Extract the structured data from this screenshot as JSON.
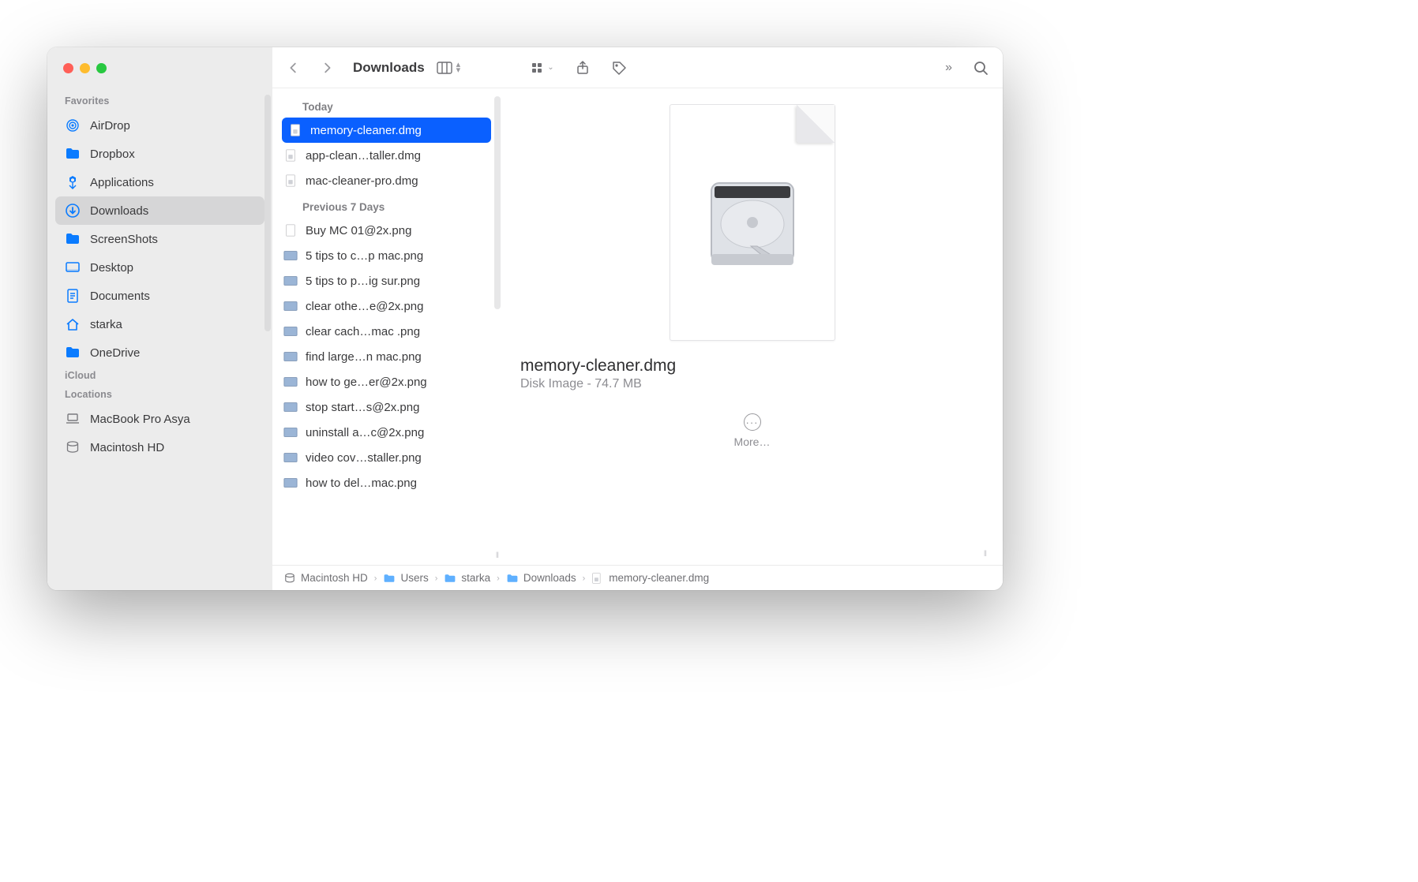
{
  "window_title": "Downloads",
  "sidebar": {
    "sections": [
      {
        "label": "Favorites",
        "items": [
          {
            "id": "airdrop",
            "label": "AirDrop",
            "icon": "airdrop-icon"
          },
          {
            "id": "dropbox",
            "label": "Dropbox",
            "icon": "folder-icon"
          },
          {
            "id": "applications",
            "label": "Applications",
            "icon": "applications-icon"
          },
          {
            "id": "downloads",
            "label": "Downloads",
            "icon": "downloads-icon",
            "active": true
          },
          {
            "id": "screenshots",
            "label": "ScreenShots",
            "icon": "folder-icon"
          },
          {
            "id": "desktop",
            "label": "Desktop",
            "icon": "desktop-icon"
          },
          {
            "id": "documents",
            "label": "Documents",
            "icon": "documents-icon"
          },
          {
            "id": "starka",
            "label": "starka",
            "icon": "home-icon"
          },
          {
            "id": "onedrive",
            "label": "OneDrive",
            "icon": "folder-icon"
          }
        ]
      },
      {
        "label": "iCloud",
        "items": []
      },
      {
        "label": "Locations",
        "items": [
          {
            "id": "macbook",
            "label": "MacBook Pro Asya",
            "icon": "laptop-icon",
            "gray": true
          },
          {
            "id": "hd",
            "label": "Macintosh HD",
            "icon": "disk-icon",
            "gray": true
          }
        ]
      }
    ]
  },
  "file_list": {
    "groups": [
      {
        "label": "Today",
        "rows": [
          {
            "name": "memory-cleaner.dmg",
            "type": "dmg",
            "selected": true
          },
          {
            "name": "app-clean…taller.dmg",
            "type": "dmg"
          },
          {
            "name": "mac-cleaner-pro.dmg",
            "type": "dmg"
          }
        ]
      },
      {
        "label": "Previous 7 Days",
        "rows": [
          {
            "name": "Buy MC 01@2x.png",
            "type": "png-blank"
          },
          {
            "name": "5 tips to c…p mac.png",
            "type": "png"
          },
          {
            "name": "5 tips to p…ig sur.png",
            "type": "png"
          },
          {
            "name": "clear othe…e@2x.png",
            "type": "png"
          },
          {
            "name": "clear cach…mac .png",
            "type": "png"
          },
          {
            "name": "find large…n mac.png",
            "type": "png"
          },
          {
            "name": "how to ge…er@2x.png",
            "type": "png"
          },
          {
            "name": "stop start…s@2x.png",
            "type": "png"
          },
          {
            "name": "uninstall a…c@2x.png",
            "type": "png"
          },
          {
            "name": "video cov…staller.png",
            "type": "png"
          },
          {
            "name": "how to del…mac.png",
            "type": "png"
          }
        ]
      }
    ]
  },
  "preview": {
    "filename": "memory-cleaner.dmg",
    "subtitle": "Disk Image - 74.7 MB",
    "more_label": "More…"
  },
  "path": [
    {
      "label": "Macintosh HD",
      "icon": "disk"
    },
    {
      "label": "Users",
      "icon": "folder"
    },
    {
      "label": "starka",
      "icon": "folder"
    },
    {
      "label": "Downloads",
      "icon": "folder"
    },
    {
      "label": "memory-cleaner.dmg",
      "icon": "dmg"
    }
  ]
}
